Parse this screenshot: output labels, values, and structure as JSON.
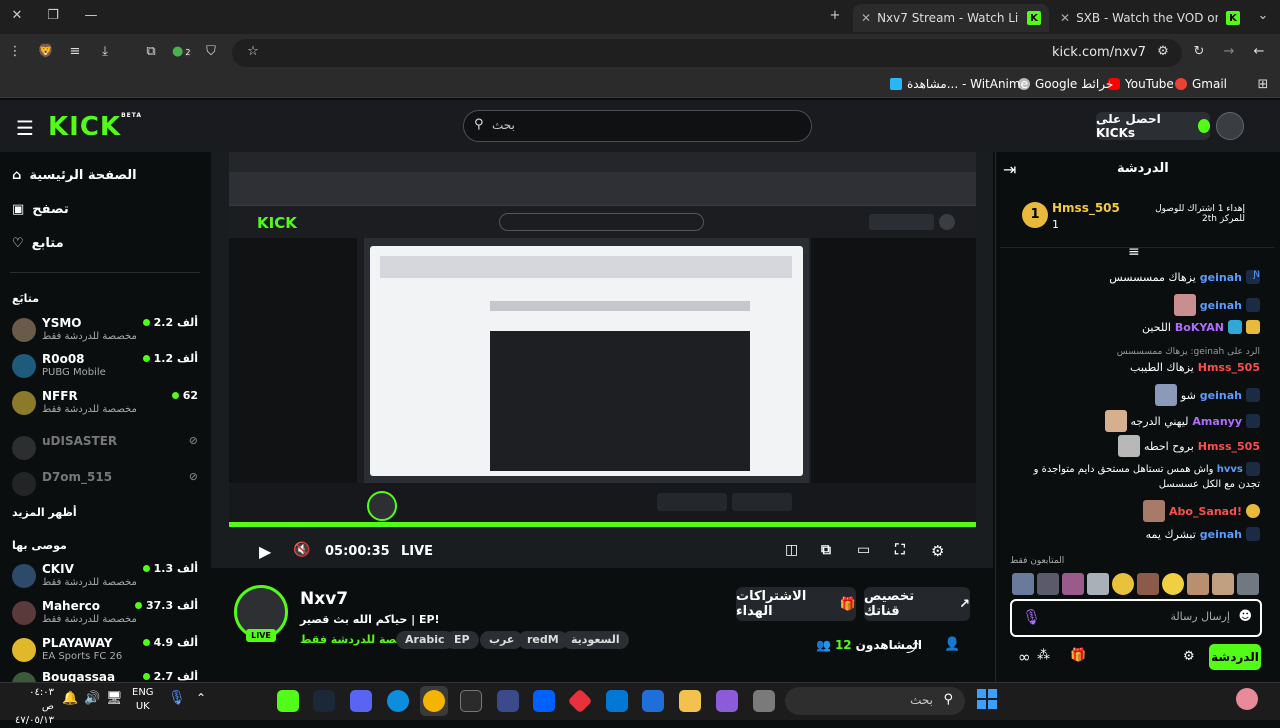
{
  "browser": {
    "tabs": [
      {
        "title": "Nxv7 Stream - Watch Live on Ki"
      },
      {
        "title": "SXB - Watch the VOD on Kick"
      }
    ],
    "url": "kick.com/nxv7",
    "extensions_badge": "2",
    "bookmarks": [
      "Gmail",
      "YouTube",
      "Google خرائط",
      "مشاهدة... - WitAnime"
    ]
  },
  "kick_header": {
    "logo": "KICK",
    "logo_beta": "BETA",
    "search_placeholder": "بحث",
    "kicks_button": "احصل على KICKs"
  },
  "sidebar": {
    "nav": [
      {
        "label": "الصفحة الرئيسية"
      },
      {
        "label": "تصفح"
      },
      {
        "label": "متابع"
      }
    ],
    "following_heading": "متابَع",
    "following": [
      {
        "name": "YSMO",
        "sub": "مخصصة للدردشة فقط",
        "viewers": "2.2 ألف",
        "live": true
      },
      {
        "name": "R0o08",
        "sub": "PUBG Mobile",
        "viewers": "1.2 ألف",
        "live": true
      },
      {
        "name": "NFFR",
        "sub": "مخصصة للدردشة فقط",
        "viewers": "62",
        "live": true
      },
      {
        "name": "uDISASTER",
        "sub": "",
        "viewers": "",
        "live": false
      },
      {
        "name": "D7om_515",
        "sub": "",
        "viewers": "",
        "live": false
      }
    ],
    "show_more": "أظهر المزيد",
    "recommended_heading": "موصى بها",
    "recommended": [
      {
        "name": "CKIV",
        "sub": "مخصصة للدردشة فقط",
        "viewers": "1.3 ألف"
      },
      {
        "name": "Maherco",
        "sub": "مخصصة للدردشة فقط",
        "viewers": "37.3 ألف"
      },
      {
        "name": "PLAYAWAY",
        "sub": "EA Sports FC 26",
        "viewers": "4.9 ألف"
      },
      {
        "name": "Bougassaa",
        "sub": "",
        "viewers": "2.7 ألف"
      }
    ]
  },
  "player": {
    "time": "05:00:35",
    "live_label": "LIVE"
  },
  "stream": {
    "channel": "Nxv7",
    "title": "حياكم الله بث قصير | EP!",
    "category": "مخصصة للدردشة فقط",
    "live_badge": "LIVE",
    "tags": [
      "السعودية",
      "redM",
      "عرب",
      "EP",
      "Arabic"
    ],
    "customize_channel": "تخصيص قناتك",
    "gift_subs": "الاشتراكات الهداء",
    "viewers_label": "المشاهدون",
    "viewers_count": "12"
  },
  "chat": {
    "title": "الدردشة",
    "pinned_text": "إهداء 1 اشتراك للوصول للمركز 2th",
    "pinned_user": "Hmss_505",
    "pinned_count": "1",
    "messages": [
      {
        "user": "geinah",
        "text": "يزهاك ممسسسس",
        "color": "#5b9cff"
      },
      {
        "user": "geinah",
        "text": "",
        "color": "#5b9cff"
      },
      {
        "user": "BoKYAN",
        "text": "اللحين",
        "color": "#b06cff"
      },
      {
        "user": "Hmss_505",
        "text": "يزهاك الطيبب",
        "color": "#ff4d4d",
        "reply": "الرد على geinah: يزهاك ممسسسس"
      },
      {
        "user": "geinah",
        "text": "شو",
        "color": "#5b9cff"
      },
      {
        "user": "Amanyy",
        "text": "ليهني الدرجه",
        "color": "#b06cff"
      },
      {
        "user": "Hmss_505",
        "text": "بروح احطه",
        "color": "#ff4d4d"
      },
      {
        "user": "hvvs",
        "text": "واش همس تستاهل مستحق دايم متواجدة و تجدن مع الكل عسسسل",
        "color": "#5b9cff"
      },
      {
        "user": "!Abo_Sanad",
        "text": "",
        "color": "#ff4d4d"
      },
      {
        "user": "geinah",
        "text": "تبشرك يمه",
        "color": "#5b9cff"
      }
    ],
    "emotes_label": "المتابعون فقط",
    "input_placeholder": "إرسال رسالة",
    "send_button": "الدردشة"
  },
  "taskbar": {
    "time": "٠٤:٠٣ ص",
    "date": "٤٧/٠٥/١٣",
    "lang": "ENG",
    "region": "UK",
    "search_placeholder": "بحث"
  }
}
